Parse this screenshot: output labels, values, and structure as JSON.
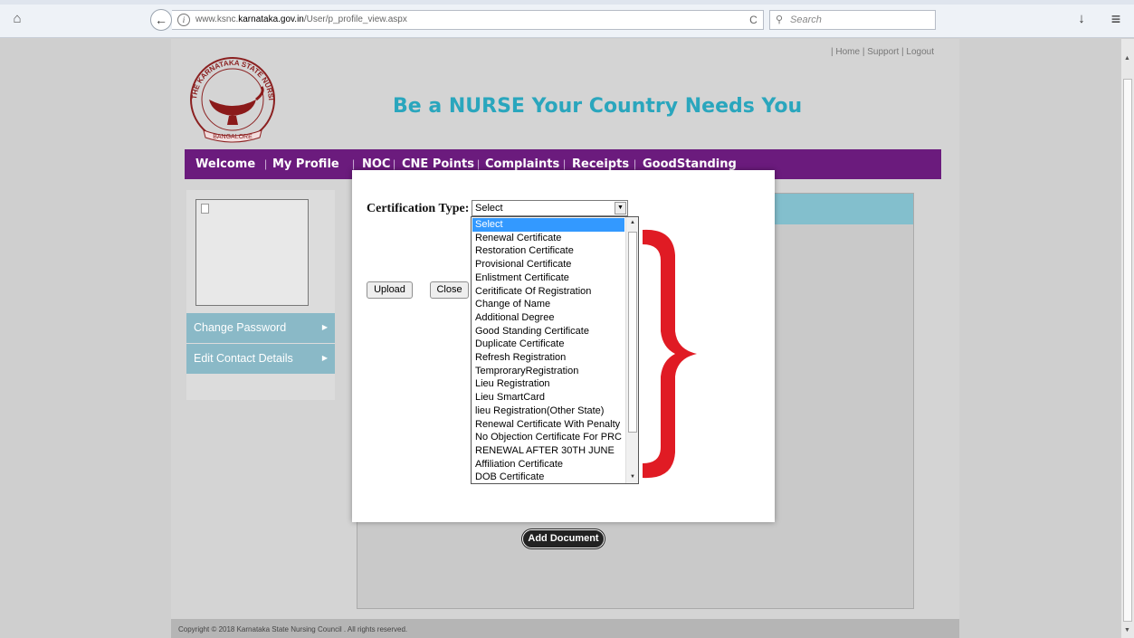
{
  "browser": {
    "url_prefix": "www.ksnc.",
    "url_domain": "karnataka.gov.in",
    "url_path": "/User/p_profile_view.aspx",
    "search_placeholder": "Search",
    "info_glyph": "i",
    "reload_glyph": "C"
  },
  "header": {
    "top_links": "| Home  | Support  | Logout",
    "tagline": "Be a NURSE Your Country Needs You",
    "logo_top_text": "THE KARNATAKA STATE NURSING COUNCIL",
    "logo_bottom_text": "BANGALORE"
  },
  "nav": {
    "items": [
      "Welcome",
      "My Profile",
      "NOC",
      "CNE Points",
      "Complaints",
      "Receipts",
      "GoodStanding"
    ],
    "separator": "|"
  },
  "sidebar": {
    "items": [
      "Change Password",
      "Edit Contact Details"
    ]
  },
  "content": {
    "add_document_label": "Add Document"
  },
  "modal": {
    "certification_label": "Certification Type:",
    "selected_value": "Select",
    "upload_label": "Upload",
    "close_label": "Close"
  },
  "dropdown": {
    "options": [
      "Select",
      "Renewal Certificate",
      "Restoration Certificate",
      "Provisional Certificate",
      "Enlistment Certificate",
      "Ceritificate Of Registration",
      "Change of Name",
      "Additional Degree",
      "Good Standing Certificate",
      "Duplicate Certificate",
      "Refresh Registration",
      "TemproraryRegistration",
      "Lieu Registration",
      "Lieu SmartCard",
      "lieu Registration(Other State)",
      "Renewal Certificate With Penalty",
      "No Objection Certificate For PRC",
      "RENEWAL AFTER 30TH JUNE",
      "Affiliation Certificate",
      "DOB Certificate"
    ],
    "selected_index": 0
  },
  "footer": {
    "text": "Copyright © 2018 Karnataka State Nursing Council . All rights reserved."
  },
  "colors": {
    "nav_bg": "#6b1b7d",
    "tagline": "#2aa6bd",
    "sidebar_item": "#8ab9c7",
    "annotation_brace": "#e01b24"
  }
}
